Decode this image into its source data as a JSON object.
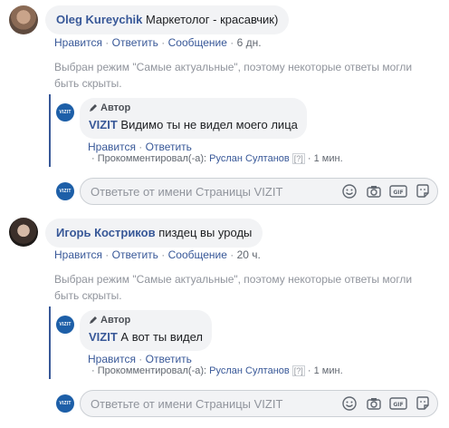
{
  "comments": [
    {
      "author": "Oleg Kureychik",
      "text": "Маркетолог - красавчик)",
      "like": "Нравится",
      "reply": "Ответить",
      "message": "Сообщение",
      "time": "6 дн.",
      "notice": "Выбран режим \"Самые актуальные\", поэтому некоторые ответы могли быть скрыты.",
      "reply_item": {
        "badge": "Автор",
        "page_name": "VIZIT",
        "text": "Видимо ты не видел моего лица",
        "like": "Нравится",
        "reply": "Ответить",
        "commented_by": "Прокомментировал(-а):",
        "commenter": "Руслан Султанов",
        "help": "[?]",
        "time": "1 мин."
      }
    },
    {
      "author": "Игорь Костриков",
      "text": "пиздец вы уроды",
      "like": "Нравится",
      "reply": "Ответить",
      "message": "Сообщение",
      "time": "20 ч.",
      "notice": "Выбран режим \"Самые актуальные\", поэтому некоторые ответы могли быть скрыты.",
      "reply_item": {
        "badge": "Автор",
        "page_name": "VIZIT",
        "text": "А вот ты видел",
        "like": "Нравится",
        "reply": "Ответить",
        "commented_by": "Прокомментировал(-а):",
        "commenter": "Руслан Султанов",
        "help": "[?]",
        "time": "1 мин."
      }
    }
  ],
  "reply_box": {
    "placeholder": "Ответьте от имени Страницы VIZIT",
    "icons": [
      "emoji-icon",
      "camera-icon",
      "gif-icon",
      "sticker-icon"
    ]
  },
  "page_avatar_text": "VIZIT",
  "dot": "·",
  "colors": {
    "link": "#385898",
    "bubble": "#f2f3f5",
    "page_avatar": "#1d5fa8"
  }
}
